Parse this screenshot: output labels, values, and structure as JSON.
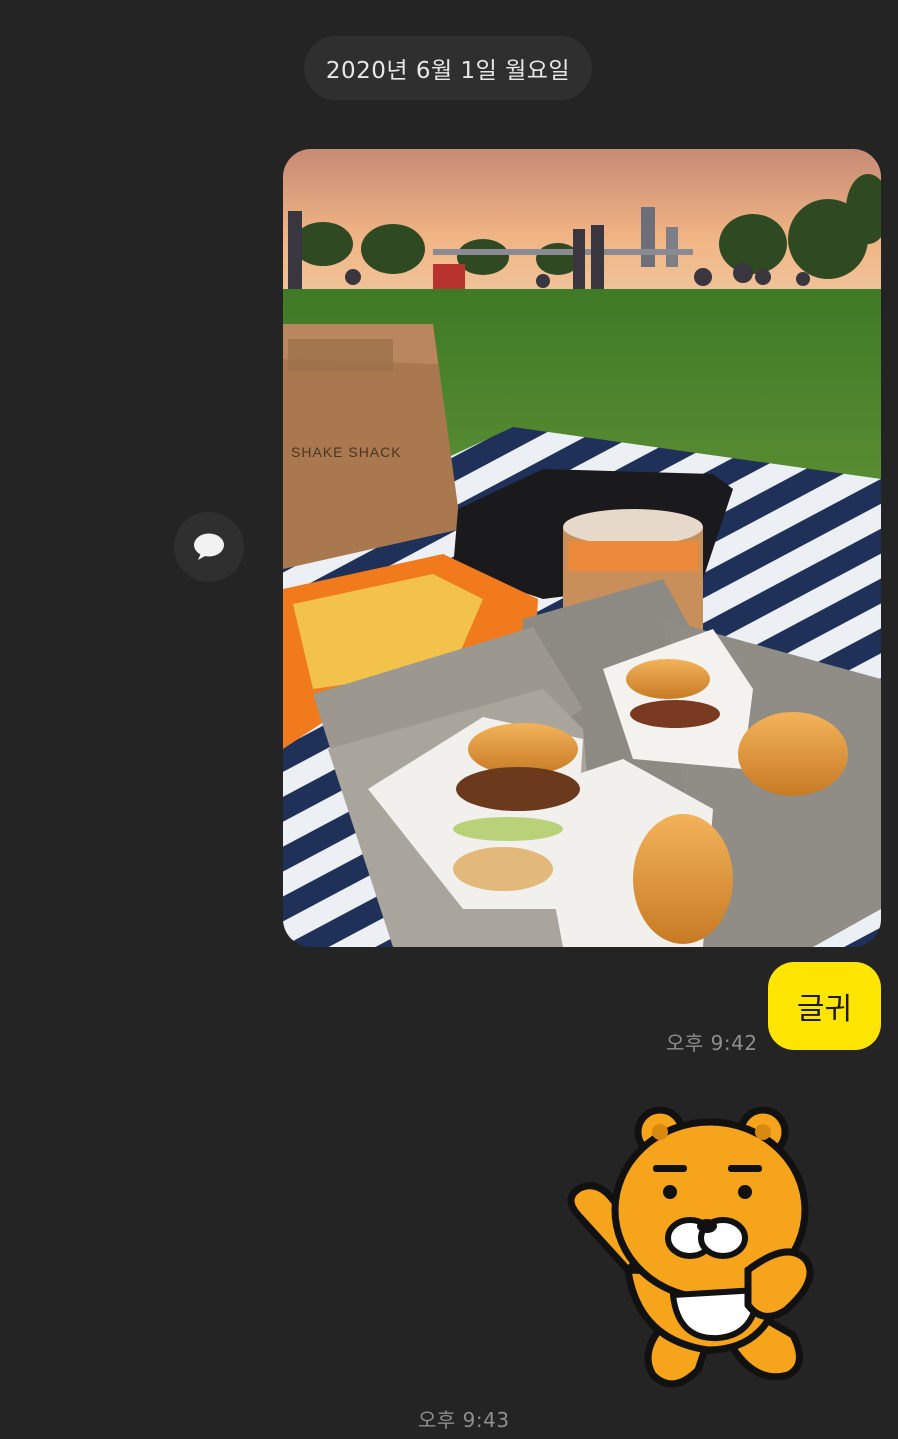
{
  "chat": {
    "date_divider": "2020년 6월 1일 월요일",
    "photo_message": {
      "bag_brand": "SHAKE SHACK"
    },
    "text_message": {
      "text": "글귀",
      "time": "오후 9:42"
    },
    "sticker_message": {
      "time": "오후 9:43"
    }
  },
  "colors": {
    "background": "#242424",
    "bubble": "#fee500"
  },
  "icons": {
    "share": "speech-bubble-icon",
    "sticker": "ryan-bear-sticker"
  }
}
